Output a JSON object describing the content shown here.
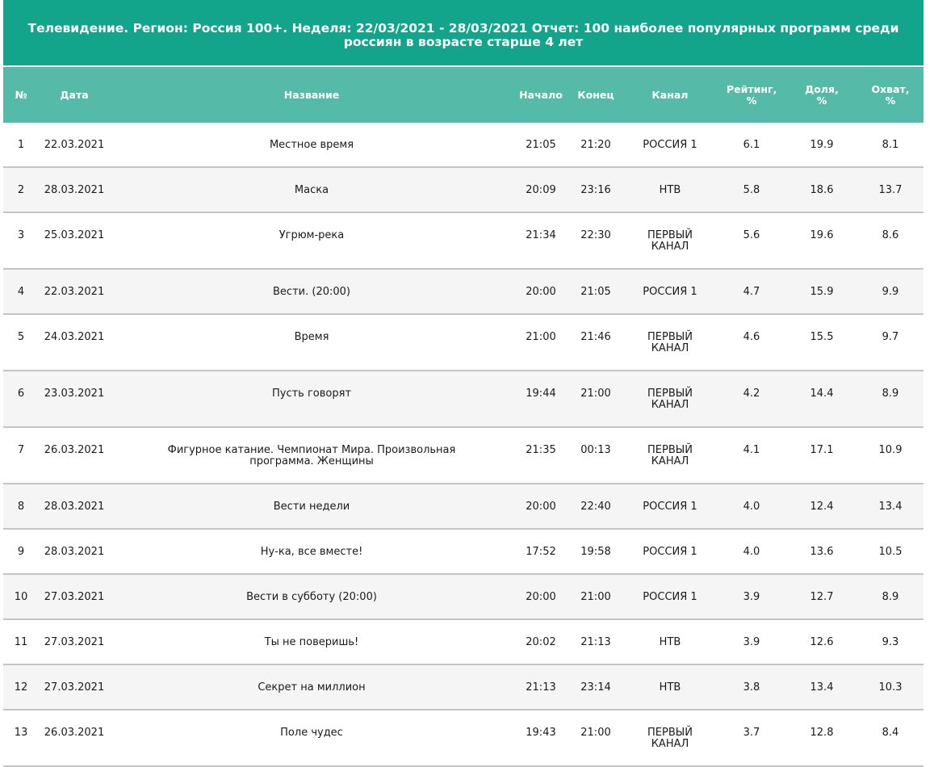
{
  "title": "Телевидение. Регион: Россия 100+. Неделя: 22/03/2021 - 28/03/2021 Отчет: 100 наиболее популярных программ среди россиян в возрасте старше 4 лет",
  "columns": {
    "num": "№",
    "date": "Дата",
    "name": "Название",
    "start": "Начало",
    "end": "Конец",
    "channel": "Канал",
    "rating": "Рейтинг, %",
    "share": "Доля, %",
    "reach": "Охват, %"
  },
  "rows": [
    {
      "num": "1",
      "date": "22.03.2021",
      "name": "Местное время",
      "start": "21:05",
      "end": "21:20",
      "channel": "РОССИЯ 1",
      "rating": "6.1",
      "share": "19.9",
      "reach": "8.1"
    },
    {
      "num": "2",
      "date": "28.03.2021",
      "name": "Маска",
      "start": "20:09",
      "end": "23:16",
      "channel": "НТВ",
      "rating": "5.8",
      "share": "18.6",
      "reach": "13.7"
    },
    {
      "num": "3",
      "date": "25.03.2021",
      "name": "Угрюм-река",
      "start": "21:34",
      "end": "22:30",
      "channel": "ПЕРВЫЙ КАНАЛ",
      "rating": "5.6",
      "share": "19.6",
      "reach": "8.6"
    },
    {
      "num": "4",
      "date": "22.03.2021",
      "name": "Вести. (20:00)",
      "start": "20:00",
      "end": "21:05",
      "channel": "РОССИЯ 1",
      "rating": "4.7",
      "share": "15.9",
      "reach": "9.9"
    },
    {
      "num": "5",
      "date": "24.03.2021",
      "name": "Время",
      "start": "21:00",
      "end": "21:46",
      "channel": "ПЕРВЫЙ КАНАЛ",
      "rating": "4.6",
      "share": "15.5",
      "reach": "9.7"
    },
    {
      "num": "6",
      "date": "23.03.2021",
      "name": "Пусть говорят",
      "start": "19:44",
      "end": "21:00",
      "channel": "ПЕРВЫЙ КАНАЛ",
      "rating": "4.2",
      "share": "14.4",
      "reach": "8.9"
    },
    {
      "num": "7",
      "date": "26.03.2021",
      "name": "Фигурное катание. Чемпионат Мира. Произвольная программа. Женщины",
      "start": "21:35",
      "end": "00:13",
      "channel": "ПЕРВЫЙ КАНАЛ",
      "rating": "4.1",
      "share": "17.1",
      "reach": "10.9"
    },
    {
      "num": "8",
      "date": "28.03.2021",
      "name": "Вести недели",
      "start": "20:00",
      "end": "22:40",
      "channel": "РОССИЯ 1",
      "rating": "4.0",
      "share": "12.4",
      "reach": "13.4"
    },
    {
      "num": "9",
      "date": "28.03.2021",
      "name": "Ну-ка, все вместе!",
      "start": "17:52",
      "end": "19:58",
      "channel": "РОССИЯ 1",
      "rating": "4.0",
      "share": "13.6",
      "reach": "10.5"
    },
    {
      "num": "10",
      "date": "27.03.2021",
      "name": "Вести в субботу (20:00)",
      "start": "20:00",
      "end": "21:00",
      "channel": "РОССИЯ 1",
      "rating": "3.9",
      "share": "12.7",
      "reach": "8.9"
    },
    {
      "num": "11",
      "date": "27.03.2021",
      "name": "Ты не поверишь!",
      "start": "20:02",
      "end": "21:13",
      "channel": "НТВ",
      "rating": "3.9",
      "share": "12.6",
      "reach": "9.3"
    },
    {
      "num": "12",
      "date": "27.03.2021",
      "name": "Секрет на миллион",
      "start": "21:13",
      "end": "23:14",
      "channel": "НТВ",
      "rating": "3.8",
      "share": "13.4",
      "reach": "10.3"
    },
    {
      "num": "13",
      "date": "26.03.2021",
      "name": "Поле чудес",
      "start": "19:43",
      "end": "21:00",
      "channel": "ПЕРВЫЙ КАНАЛ",
      "rating": "3.7",
      "share": "12.8",
      "reach": "8.4"
    }
  ]
}
